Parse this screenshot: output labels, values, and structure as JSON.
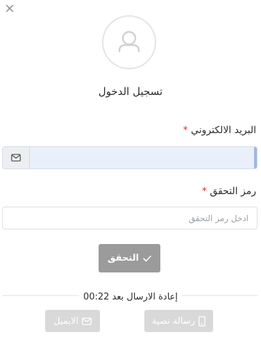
{
  "dialog": {
    "close_symbol": "×",
    "title": "تسجيل الدخول"
  },
  "email_field": {
    "label": "البريد الالكتروني",
    "required_mark": "*",
    "value": "",
    "placeholder": "",
    "icon": "envelope-icon"
  },
  "code_field": {
    "label": "رمز التحقق",
    "required_mark": "*",
    "value": "",
    "placeholder": "ادخل رمز التحقق"
  },
  "verify_button": {
    "label": "التحقق",
    "icon": "check-icon"
  },
  "resend": {
    "text": "إعادة الارسال بعد 00:22"
  },
  "alt_methods": {
    "sms_label": "رسالة نصية",
    "sms_icon": "mobile-icon",
    "email_label": "الايميل",
    "email_icon": "envelope-icon"
  },
  "colors": {
    "verify_button_bg": "#9b9b9b",
    "alt_button_bg": "#d9d9d9",
    "required": "#d9302c"
  }
}
